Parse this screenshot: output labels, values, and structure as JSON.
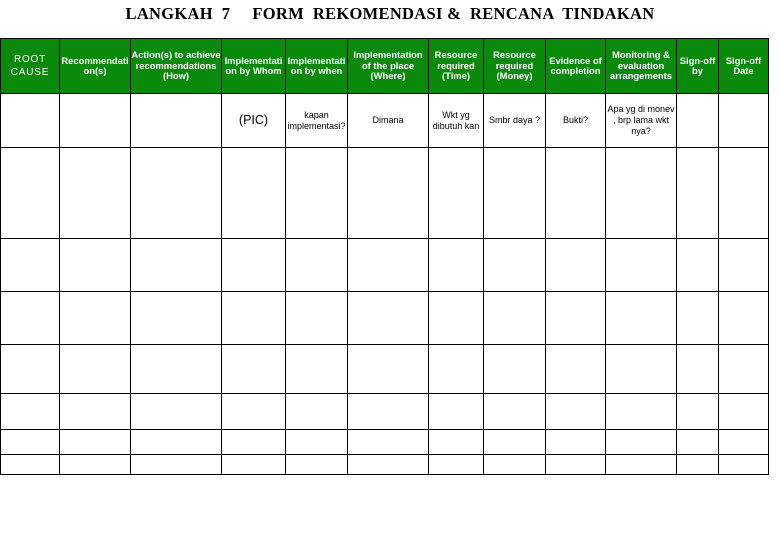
{
  "document": {
    "title": "LANGKAH  7     FORM  REKOMENDASI &  RENCANA  TINDAKAN",
    "accent_color": "#0a8a0a",
    "header_text_color": "#ffffff",
    "border_color": "#000000",
    "background_color": "#ffffff"
  },
  "table": {
    "columns": [
      {
        "key": "root_cause",
        "label": "ROOT CAUSE"
      },
      {
        "key": "recommendations",
        "label": "Recommendation(s)"
      },
      {
        "key": "actions",
        "label": "Action(s) to achieve recommendations (How)"
      },
      {
        "key": "impl_by_whom",
        "label": "Implementation by Whom"
      },
      {
        "key": "impl_by_when",
        "label": "Implementation by when"
      },
      {
        "key": "impl_place",
        "label": "Implementation of the place (Where)"
      },
      {
        "key": "resource_time",
        "label": "Resource required (Time)"
      },
      {
        "key": "resource_money",
        "label": "Resource required (Money)"
      },
      {
        "key": "evidence",
        "label": "Evidence of completion"
      },
      {
        "key": "monitoring",
        "label": "Monitoring & evaluation arrangements"
      },
      {
        "key": "signoff_by",
        "label": "Sign-off by"
      },
      {
        "key": "signoff_date",
        "label": "Sign-off Date"
      }
    ],
    "rows": [
      {
        "root_cause": "",
        "recommendations": "",
        "actions": "",
        "impl_by_whom": "(PIC)",
        "impl_by_when": "kapan implementasi?",
        "impl_place": "Dimana",
        "resource_time": "Wkt yg dibutuh kan",
        "resource_money": "Smbr daya ?",
        "evidence": "Bukti?",
        "monitoring": "Apa yg di monev , brp lama wkt nya?",
        "signoff_by": "",
        "signoff_date": ""
      },
      {
        "root_cause": "",
        "recommendations": "",
        "actions": "",
        "impl_by_whom": "",
        "impl_by_when": "",
        "impl_place": "",
        "resource_time": "",
        "resource_money": "",
        "evidence": "",
        "monitoring": "",
        "signoff_by": "",
        "signoff_date": ""
      },
      {
        "root_cause": "",
        "recommendations": "",
        "actions": "",
        "impl_by_whom": "",
        "impl_by_when": "",
        "impl_place": "",
        "resource_time": "",
        "resource_money": "",
        "evidence": "",
        "monitoring": "",
        "signoff_by": "",
        "signoff_date": ""
      },
      {
        "root_cause": "",
        "recommendations": "",
        "actions": "",
        "impl_by_whom": "",
        "impl_by_when": "",
        "impl_place": "",
        "resource_time": "",
        "resource_money": "",
        "evidence": "",
        "monitoring": "",
        "signoff_by": "",
        "signoff_date": ""
      },
      {
        "root_cause": "",
        "recommendations": "",
        "actions": "",
        "impl_by_whom": "",
        "impl_by_when": "",
        "impl_place": "",
        "resource_time": "",
        "resource_money": "",
        "evidence": "",
        "monitoring": "",
        "signoff_by": "",
        "signoff_date": ""
      },
      {
        "root_cause": "",
        "recommendations": "",
        "actions": "",
        "impl_by_whom": "",
        "impl_by_when": "",
        "impl_place": "",
        "resource_time": "",
        "resource_money": "",
        "evidence": "",
        "monitoring": "",
        "signoff_by": "",
        "signoff_date": ""
      },
      {
        "root_cause": "",
        "recommendations": "",
        "actions": "",
        "impl_by_whom": "",
        "impl_by_when": "",
        "impl_place": "",
        "resource_time": "",
        "resource_money": "",
        "evidence": "",
        "monitoring": "",
        "signoff_by": "",
        "signoff_date": ""
      },
      {
        "root_cause": "",
        "recommendations": "",
        "actions": "",
        "impl_by_whom": "",
        "impl_by_when": "",
        "impl_place": "",
        "resource_time": "",
        "resource_money": "",
        "evidence": "",
        "monitoring": "",
        "signoff_by": "",
        "signoff_date": ""
      }
    ]
  }
}
